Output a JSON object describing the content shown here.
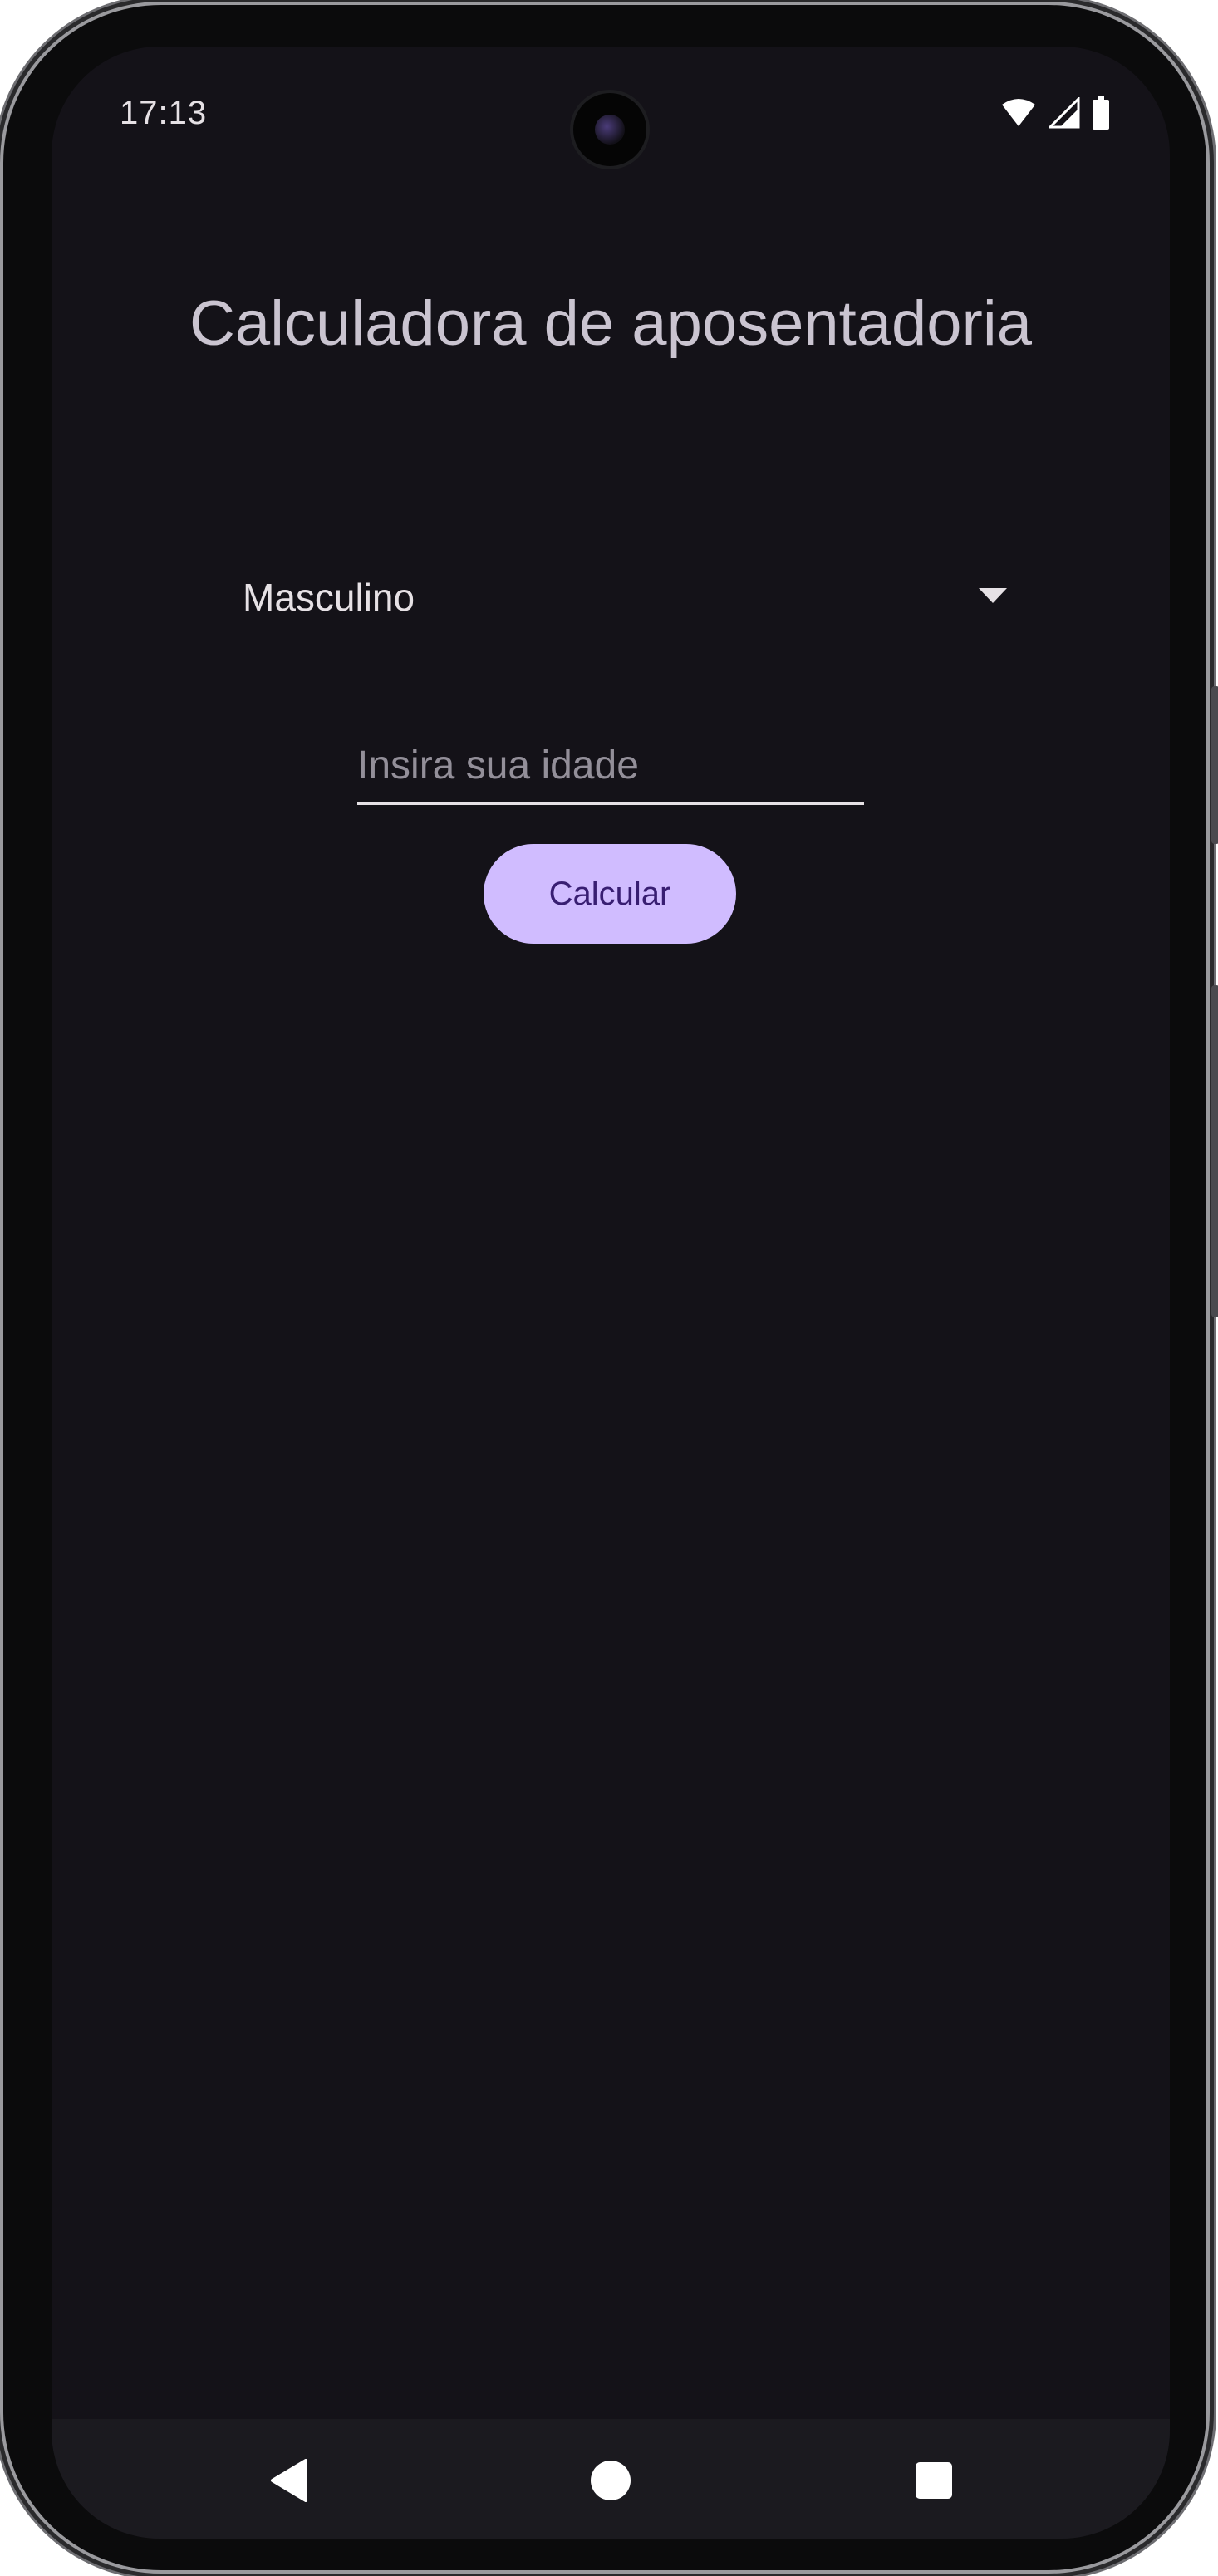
{
  "status_bar": {
    "time": "17:13",
    "icons": [
      "wifi-icon",
      "cellular-signal-icon",
      "battery-icon"
    ]
  },
  "app": {
    "title": "Calculadora de aposentadoria"
  },
  "form": {
    "gender_select": {
      "selected": "Masculino"
    },
    "age_input": {
      "value": "",
      "placeholder": "Insira sua idade"
    },
    "calculate_button_label": "Calcular"
  },
  "navigation_bar": {
    "buttons": [
      "back-icon",
      "home-icon",
      "recents-icon"
    ]
  },
  "colors": {
    "background": "#141218",
    "primary_button": "#d0bcff",
    "primary_button_text": "#381e72",
    "title_text": "#cac4d0",
    "nav_bar": "#1b1a1f"
  }
}
